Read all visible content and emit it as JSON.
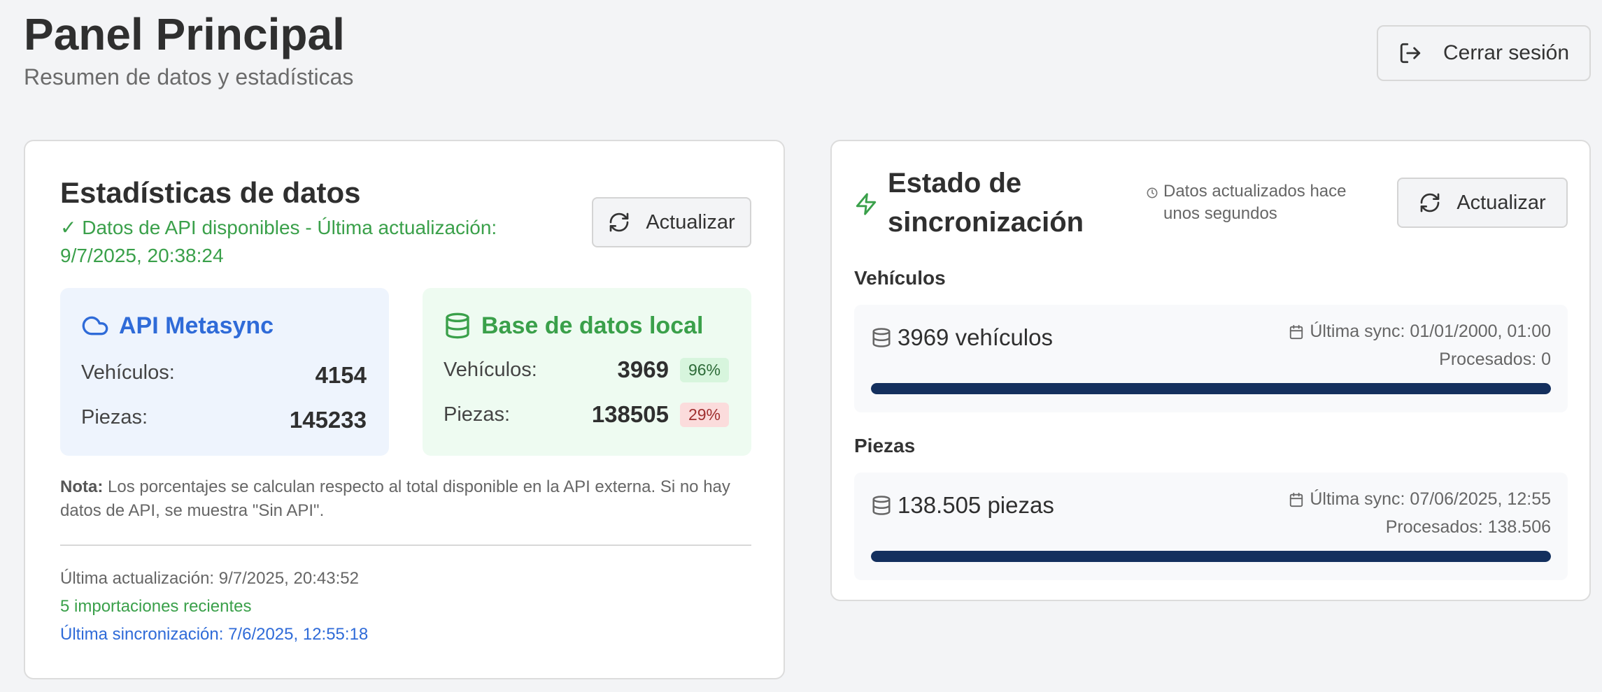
{
  "header": {
    "title": "Panel Principal",
    "subtitle": "Resumen de datos y estadísticas",
    "logout_label": "Cerrar sesión"
  },
  "stats": {
    "title": "Estadísticas de datos",
    "api_status": "✓ Datos de API disponibles - Última actualización: 9/7/2025, 20:38:24",
    "refresh_label": "Actualizar",
    "api_box": {
      "title": "API Metasync",
      "vehicles_label": "Vehículos:",
      "vehicles_value": "4154",
      "parts_label": "Piezas:",
      "parts_value": "145233"
    },
    "local_box": {
      "title": "Base de datos local",
      "vehicles_label": "Vehículos:",
      "vehicles_value": "3969",
      "vehicles_pct": "96%",
      "parts_label": "Piezas:",
      "parts_value": "138505",
      "parts_pct": "29%"
    },
    "note_bold": "Nota:",
    "note_text": " Los porcentajes se calculan respecto al total disponible en la API externa. Si no hay datos de API, se muestra \"Sin API\".",
    "last_update": "Última actualización: 9/7/2025, 20:43:52",
    "recent_imports": "5 importaciones recientes",
    "last_sync": "Última sincronización: 7/6/2025, 12:55:18"
  },
  "sync": {
    "title": "Estado de sincronización",
    "updated_text": "Datos actualizados hace unos segundos",
    "refresh_label": "Actualizar",
    "vehicles": {
      "section_label": "Vehículos",
      "count": "3969 vehículos",
      "last_sync": "Última sync: 01/01/2000, 01:00",
      "processed": "Procesados: 0",
      "progress": 1.0
    },
    "parts": {
      "section_label": "Piezas",
      "count": "138.505 piezas",
      "last_sync": "Última sync: 07/06/2025, 12:55",
      "processed": "Procesados: 138.506",
      "progress": 1.0
    }
  },
  "colors": {
    "accent_green": "#3aa04a",
    "accent_blue": "#2f6bd8",
    "progress_fill": "#14305e"
  },
  "icons": [
    "logout-icon",
    "refresh-icon",
    "cloud-icon",
    "database-icon",
    "zap-icon",
    "clock-icon",
    "calendar-icon"
  ]
}
